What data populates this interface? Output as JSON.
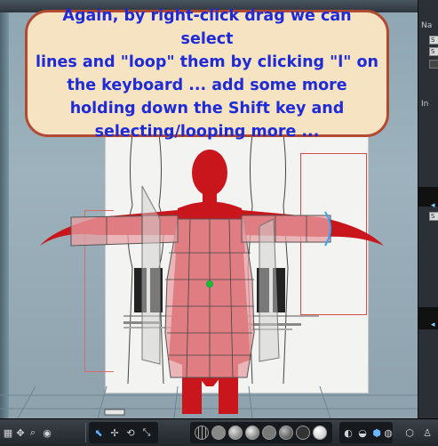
{
  "callout": {
    "text": "Again, by right-click drag we can select\nlines and \"loop\" them by clicking \"l\" on\nthe keyboard ... add some more\nholding down the Shift key and\nselecting/looping more ..."
  },
  "right_panel": {
    "label_1": "Na",
    "label_2": "In",
    "btn_label": "S"
  },
  "colors": {
    "figure_red": "#c8161c",
    "selection_pink": "#e8a0a4",
    "callout_text": "#1f2bd6",
    "callout_border": "#b24a32",
    "callout_bg": "#f5e3c2"
  },
  "icons": {
    "left_group": [
      "grid-icon",
      "move-view-icon",
      "zoom-icon",
      "orbit-icon"
    ],
    "tools": [
      "select-tool-icon",
      "move-tool-icon",
      "rotate-tool-icon",
      "scale-tool-icon"
    ],
    "shading": [
      "wireframe-sphere-icon",
      "flat-grid-sphere-icon",
      "lined-sphere-icon",
      "smooth-lined-sphere-icon",
      "texture-sphere-icon",
      "shaded-sphere-icon",
      "dark-sphere-icon",
      "white-sphere-icon"
    ],
    "view": [
      "lights-icon",
      "camera-icon",
      "hex-icon",
      "render-icon"
    ]
  }
}
